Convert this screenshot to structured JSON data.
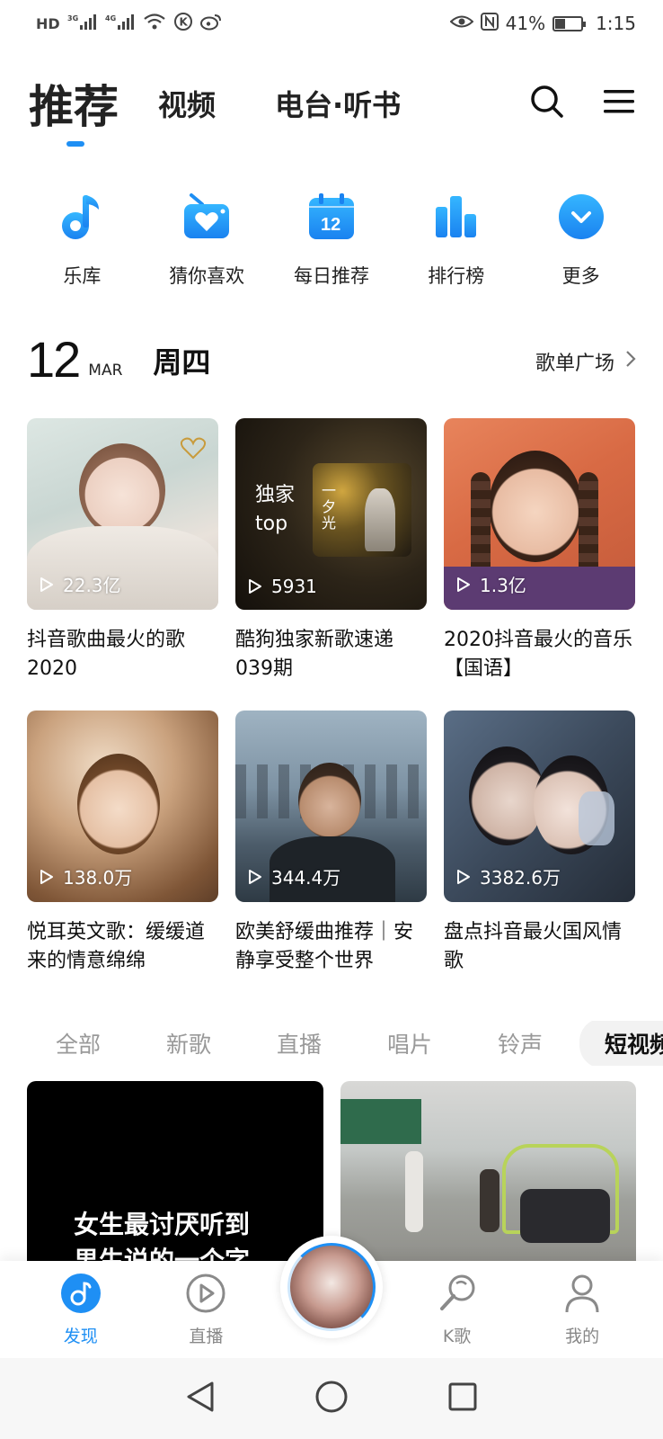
{
  "status_bar": {
    "battery": "41%",
    "battery_level": 0.41,
    "time": "1:15",
    "hd": "HD",
    "net1": "3G",
    "net2": "4G"
  },
  "top_tabs": {
    "recommend": "推荐",
    "video": "视频",
    "radio": "电台·听书"
  },
  "quick": [
    {
      "label": "乐库",
      "icon": "music-note-icon"
    },
    {
      "label": "猜你喜欢",
      "icon": "radio-heart-icon"
    },
    {
      "label": "每日推荐",
      "icon": "calendar-icon",
      "num": "12"
    },
    {
      "label": "排行榜",
      "icon": "bars-icon"
    },
    {
      "label": "更多",
      "icon": "chevron-down-icon"
    }
  ],
  "date": {
    "day": "12",
    "month": "MAR",
    "weekday": "周四",
    "plaza": "歌单广场"
  },
  "playlists": [
    {
      "plays": "22.3亿",
      "title": "抖音歌曲最火的歌2020"
    },
    {
      "plays": "5931",
      "title": "酷狗独家新歌速递039期",
      "badge": "独家\ntop",
      "badge1": "独家",
      "badge2": "top",
      "art_text": "一夕光"
    },
    {
      "plays": "1.3亿",
      "title": "2020抖音最火的音乐【国语】"
    },
    {
      "plays": "138.0万",
      "title": "悦耳英文歌：缓缓道来的情意绵绵"
    },
    {
      "plays": "344.4万",
      "title": "欧美舒缓曲推荐｜安静享受整个世界"
    },
    {
      "plays": "3382.6万",
      "title": "盘点抖音最火国风情歌"
    }
  ],
  "categories": [
    "全部",
    "新歌",
    "直播",
    "唱片",
    "铃声",
    "短视频"
  ],
  "videos": {
    "caption": "女生最讨厌听到\n男生说的一个字",
    "caption1": "女生最讨厌听到",
    "caption2": "男生说的一个字"
  },
  "bottom_nav": {
    "discover": "发现",
    "live": "直播",
    "karaoke": "K歌",
    "mine": "我的"
  },
  "colors": {
    "accent": "#1e8ff4"
  }
}
